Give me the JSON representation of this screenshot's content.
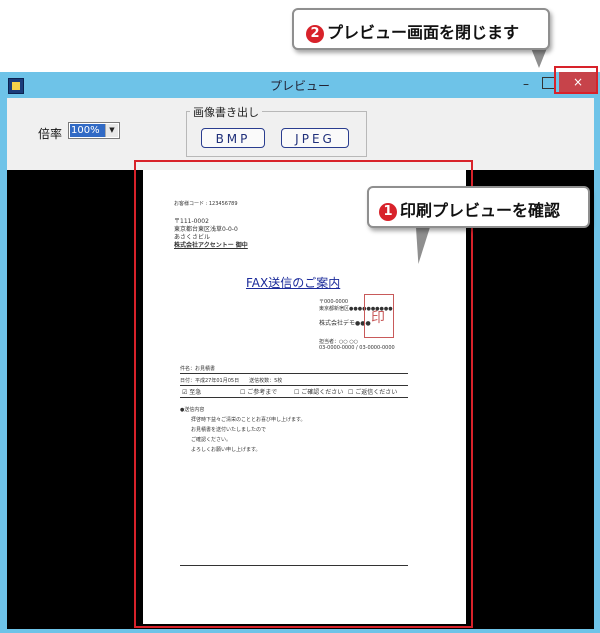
{
  "window": {
    "title": "プレビュー",
    "minimize_glyph": "–",
    "close_glyph": "×"
  },
  "toolbar": {
    "zoom_label": "倍率",
    "zoom_value": "100%",
    "export_group_label": "画像書き出し",
    "bmp_label": "BMP",
    "jpeg_label": "JPEG"
  },
  "document": {
    "header_left": "お客様コード : 123456789",
    "address_lines": [
      "〒111-0002",
      "東京都台東区浅草0-0-0",
      "あさくさビル",
      "株式会社アクセントー 御中"
    ],
    "title": "FAX送信のご案内",
    "sender_lines": [
      "〒000-0000",
      "東京都新宿区●●●●●●●●●●",
      "株式会社デモ●●●"
    ],
    "stamp_text": "印",
    "contact": "担当者：○○ ○○",
    "contact_phone": "03-0000-0000 / 03-0000-0000",
    "subject": "件名：お見積書",
    "date_line": "日付：平成27年01月05日　　送信枚数：5枚",
    "checkboxes": [
      "至急",
      "ご参考まで",
      "ご確認ください",
      "ご返信ください"
    ],
    "body_heading": "●送信内容",
    "body_lines": [
      "拝啓時下益々ご清栄のこととお喜び申し上げます。",
      "お見積書を送付いたしましたので",
      "ご確認ください。",
      "よろしくお願い申し上げます。"
    ]
  },
  "callouts": {
    "close_note_num": "2",
    "close_note_text": "プレビュー画面を閉じます",
    "preview_note_num": "1",
    "preview_note_text": "印刷プレビューを確認"
  },
  "colors": {
    "titlebar": "#6ec3e8",
    "close_button": "#c7434a",
    "highlight": "#d8222a",
    "preview_bg": "#000000"
  }
}
